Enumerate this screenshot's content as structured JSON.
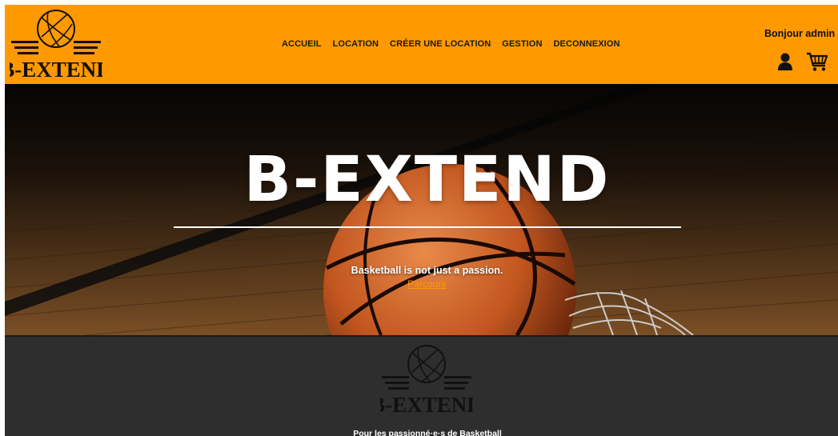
{
  "header": {
    "logo_text": "B-EXTEND",
    "nav": [
      {
        "label": "ACCUEIL"
      },
      {
        "label": "LOCATION"
      },
      {
        "label": "CRÉER UNE LOCATION"
      },
      {
        "label": "GESTION"
      },
      {
        "label": "DECONNEXION"
      }
    ],
    "greeting": "Bonjour admin",
    "icons": [
      "user-icon",
      "cart-icon"
    ]
  },
  "hero": {
    "title": "B-EXTEND",
    "tagline": "Basketball is not just a passion.",
    "link": "Parcourir"
  },
  "footer": {
    "logo_text": "B-EXTEND",
    "text": "Pour les passionné·e·s de Basketball"
  },
  "colors": {
    "accent": "#ff9900",
    "footer_bg": "#2e2e2e",
    "hero_text": "#ffffff"
  }
}
